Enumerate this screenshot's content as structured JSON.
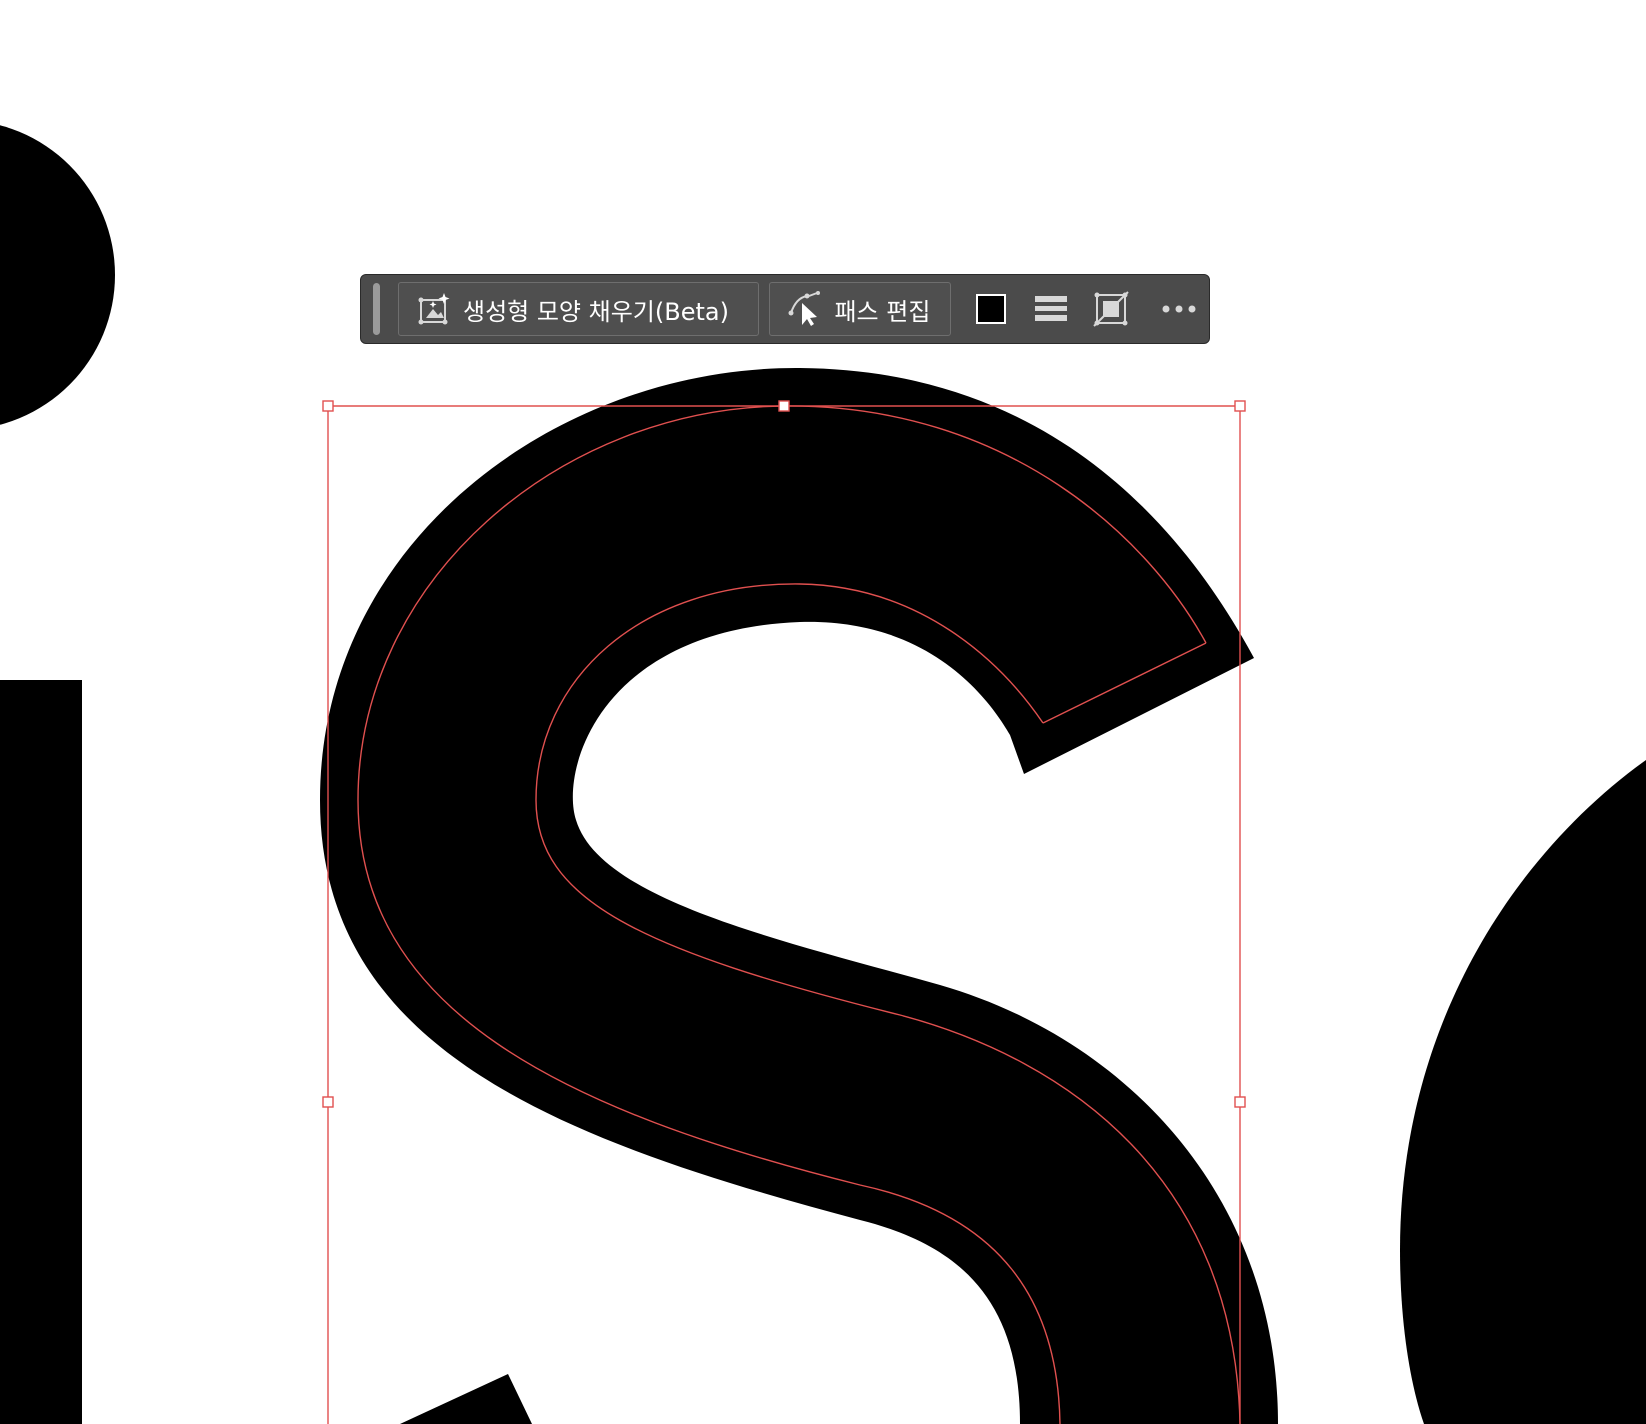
{
  "toolbar": {
    "generative_fill_label": "생성형 모양 채우기(Beta)",
    "edit_path_label": "패스 편집",
    "fill_color": "#000000",
    "icons": [
      "generative-fill-icon",
      "edit-path-icon",
      "fill-color-swatch",
      "stroke-options-icon",
      "transform-icon",
      "more-options-icon"
    ]
  },
  "colors": {
    "selection_outline": "#e0504f",
    "shape_fill": "#000000",
    "toolbar_bg": "#4b4b4b"
  }
}
